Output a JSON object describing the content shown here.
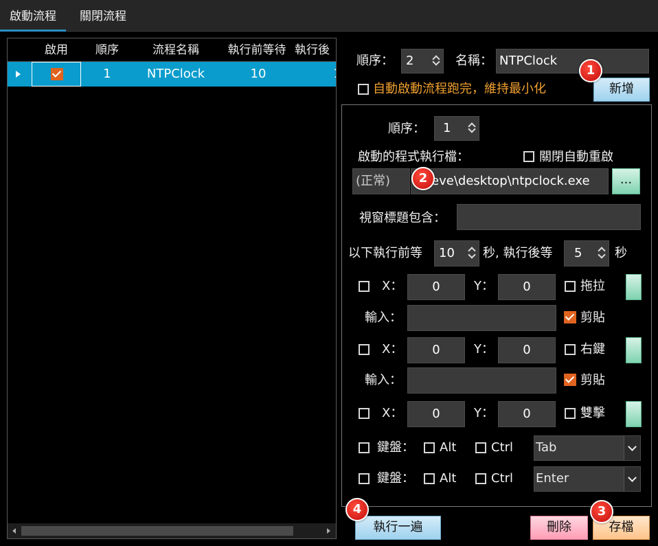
{
  "tabs": [
    {
      "label": "啟動流程"
    },
    {
      "label": "關閉流程"
    }
  ],
  "grid": {
    "columns": [
      "啟用",
      "順序",
      "流程名稱",
      "執行前等待",
      "執行後"
    ],
    "rows": [
      {
        "enabled": true,
        "order": "1",
        "name": "NTPClock",
        "wait_before": "10",
        "wait_after": "1"
      }
    ]
  },
  "top_form": {
    "order_label": "順序：",
    "order_value": "2",
    "name_label": "名稱：",
    "name_value": "NTPClock",
    "auto_minimize_label": "自動啟動流程跑完，維持最小化",
    "add_button": "新增"
  },
  "detail": {
    "order_label": "順序：",
    "order_value": "1",
    "exe_label": "啟動的程式執行檔：",
    "close_autorestart_label": "關閉自動重啟",
    "mode_value": "(正常)",
    "exe_path": "teve\\desktop\\ntpclock.exe",
    "browse_button": "...",
    "window_title_label": "視窗標題包含：",
    "window_title_value": "",
    "wait_prefix": "以下執行前等",
    "wait_before": "10",
    "wait_mid": "秒, 執行後等",
    "wait_after": "5",
    "wait_suffix": "秒",
    "x_label": "X：",
    "y_label": "Y：",
    "input_label": "輸入：",
    "paste_label": "剪貼",
    "action1": {
      "x": "0",
      "y": "0",
      "option": "拖拉",
      "input": ""
    },
    "action2": {
      "x": "0",
      "y": "0",
      "option": "右鍵",
      "input": ""
    },
    "action3": {
      "x": "0",
      "y": "0",
      "option": "雙擊"
    },
    "keyboard_label": "鍵盤：",
    "alt_label": "Alt",
    "ctrl_label": "Ctrl",
    "key1": "Tab",
    "key2": "Enter"
  },
  "buttons": {
    "run_once": "執行一遍",
    "delete": "刪除",
    "save": "存檔"
  },
  "badges": [
    "1",
    "2",
    "3",
    "4"
  ],
  "colors": {
    "selection": "#0a9ccc",
    "check_orange": "#e0641f",
    "warning_text": "#f0a030",
    "badge_red": "#d41414"
  }
}
